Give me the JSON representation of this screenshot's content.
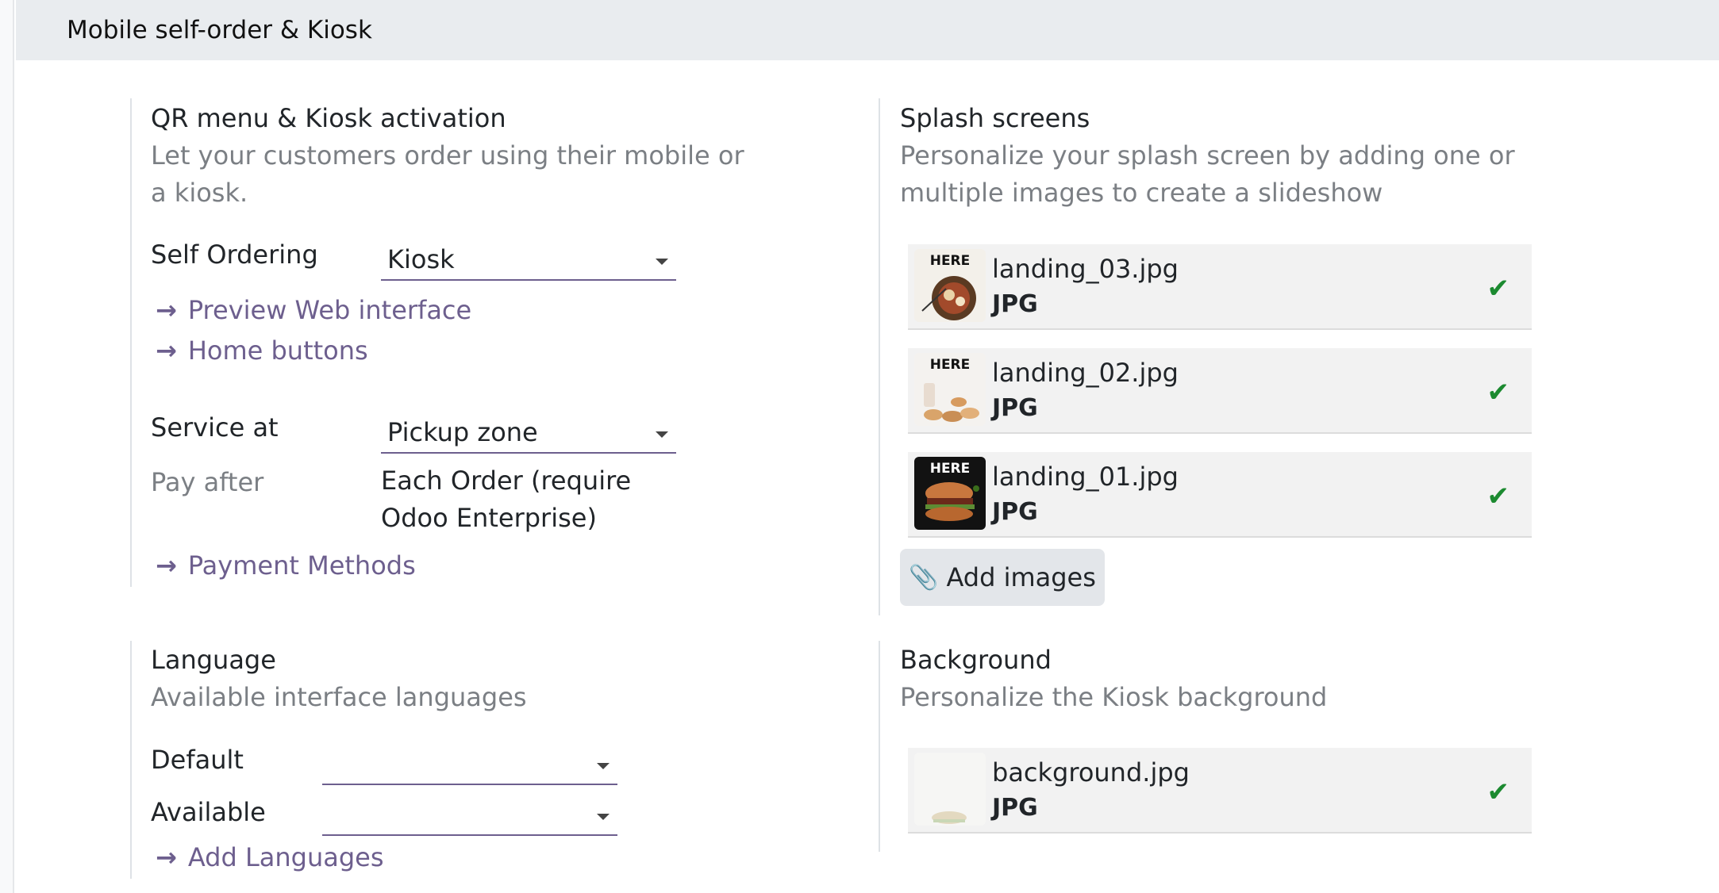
{
  "header": {
    "title": "Mobile self-order & Kiosk"
  },
  "qr": {
    "title": "QR menu & Kiosk activation",
    "description": "Let your customers order using their mobile or a kiosk.",
    "self_ordering_label": "Self Ordering",
    "self_ordering_value": "Kiosk",
    "links": {
      "preview": "Preview Web interface",
      "home_buttons": "Home buttons",
      "payment_methods": "Payment Methods"
    },
    "service_at_label": "Service at",
    "service_at_value": "Pickup zone",
    "pay_after_label": "Pay after",
    "pay_after_value_line1": "Each Order (require",
    "pay_after_value_line2": "Odoo Enterprise)"
  },
  "splash": {
    "title": "Splash screens",
    "description_line1": "Personalize your splash screen by adding one or",
    "description_line2": "multiple images to create a slideshow",
    "files": [
      {
        "name": "landing_03.jpg",
        "type": "JPG",
        "badge": "HERE"
      },
      {
        "name": "landing_02.jpg",
        "type": "JPG",
        "badge": "HERE"
      },
      {
        "name": "landing_01.jpg",
        "type": "JPG",
        "badge": "HERE"
      }
    ],
    "add_images": "Add images"
  },
  "language": {
    "title": "Language",
    "description": "Available interface languages",
    "default_label": "Default",
    "default_value": "",
    "available_label": "Available",
    "available_value": "",
    "add_languages": "Add Languages"
  },
  "background": {
    "title": "Background",
    "description": "Personalize the Kiosk background",
    "file": {
      "name": "background.jpg",
      "type": "JPG"
    }
  },
  "colors": {
    "link": "#6d5f8e",
    "check": "#1c8a30",
    "header_bg": "#e9ecef"
  },
  "icons": {
    "arrow": "arrow-right-icon",
    "check": "check-icon",
    "clip": "paperclip-icon",
    "caret": "caret-down-icon"
  }
}
